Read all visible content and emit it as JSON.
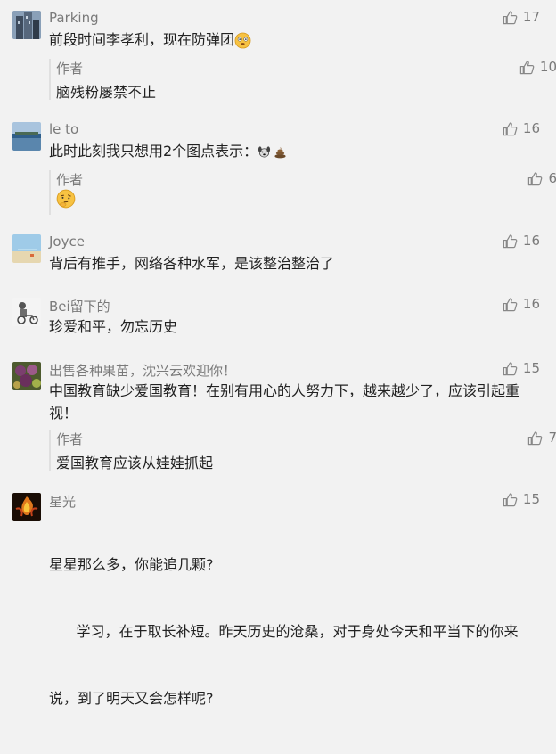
{
  "comments": [
    {
      "name": "Parking",
      "text": "前段时间李孝利，现在防弹团",
      "likes": "17",
      "reply": {
        "author": "作者",
        "text": "脑残粉屡禁不止",
        "likes": "10"
      }
    },
    {
      "name": "le to",
      "text": "此时此刻我只想用2个图点表示：",
      "likes": "16",
      "reply": {
        "author": "作者",
        "text": "",
        "likes": "6"
      }
    },
    {
      "name": "Joyce",
      "text": "背后有推手，网络各种水军，是该整治整治了",
      "likes": "16"
    },
    {
      "name": "Bei留下的",
      "text": "珍爱和平，勿忘历史",
      "likes": "16"
    },
    {
      "name": "出售各种果苗，沈兴云欢迎你！",
      "text_lines": [
        "中国教育缺少爱国教育！在别有用心的人努力下，越来越少了，应该引起重",
        "视！"
      ],
      "likes": "15",
      "reply": {
        "author": "作者",
        "text": "爱国教育应该从娃娃抓起",
        "likes": "7"
      }
    },
    {
      "name": "星光",
      "text_lines": [
        "星星那么多，你能追几颗?",
        "      学习，在于取长补短。昨天历史的沧桑，对于身处今天和平当下的你来",
        "说，到了明天又会怎样呢?"
      ],
      "likes": "15"
    }
  ],
  "icons": {
    "like": "thumbs-up-icon"
  },
  "colors": {
    "background": "#f2f2f2",
    "secondary_text": "#7a7a7a",
    "primary_text": "#222222"
  }
}
